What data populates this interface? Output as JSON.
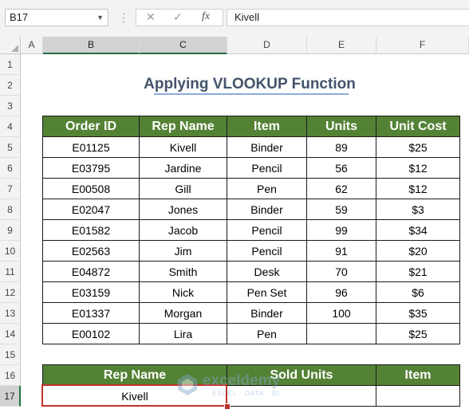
{
  "name_box": "B17",
  "formula_bar": {
    "cancel_icon": "✕",
    "enter_icon": "✓",
    "fx_label": "fx",
    "value": "Kivell"
  },
  "columns": [
    "A",
    "B",
    "C",
    "D",
    "E",
    "F"
  ],
  "rows": [
    "1",
    "2",
    "3",
    "4",
    "5",
    "6",
    "7",
    "8",
    "9",
    "10",
    "11",
    "12",
    "13",
    "14",
    "15",
    "16",
    "17"
  ],
  "title": "Applying VLOOKUP Function",
  "main_table": {
    "headers": [
      "Order ID",
      "Rep Name",
      "Item",
      "Units",
      "Unit Cost"
    ],
    "rows": [
      [
        "E01125",
        "Kivell",
        "Binder",
        "89",
        "$25"
      ],
      [
        "E03795",
        "Jardine",
        "Pencil",
        "56",
        "$12"
      ],
      [
        "E00508",
        "Gill",
        "Pen",
        "62",
        "$12"
      ],
      [
        "E02047",
        "Jones",
        "Binder",
        "59",
        "$3"
      ],
      [
        "E01582",
        "Jacob",
        "Pencil",
        "99",
        "$34"
      ],
      [
        "E02563",
        "Jim",
        "Pencil",
        "91",
        "$20"
      ],
      [
        "E04872",
        "Smith",
        "Desk",
        "70",
        "$21"
      ],
      [
        "E03159",
        "Nick",
        "Pen Set",
        "96",
        "$6"
      ],
      [
        "E01337",
        "Morgan",
        "Binder",
        "100",
        "$35"
      ],
      [
        "E00102",
        "Lira",
        "Pen",
        "",
        "$25"
      ]
    ]
  },
  "lookup_table": {
    "headers": [
      "Rep Name",
      "Sold Units",
      "Item"
    ],
    "row": [
      "Kivell",
      "",
      ""
    ]
  },
  "watermark": {
    "name": "exceldemy",
    "tagline": "EXCEL · DATA · BI"
  },
  "colors": {
    "header_green": "#548235",
    "title_blue": "#44546a",
    "selection_red": "#c0312b",
    "excel_green": "#217346"
  }
}
